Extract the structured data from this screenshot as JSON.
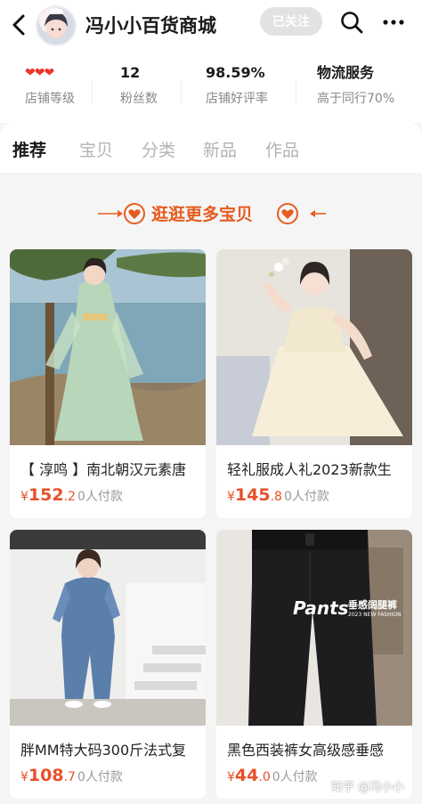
{
  "header": {
    "shop_name": "冯小小百货商城",
    "follow_label": "已关注"
  },
  "stats": [
    {
      "value": "❤❤❤",
      "label": "店铺等级"
    },
    {
      "value": "12",
      "label": "粉丝数"
    },
    {
      "value": "98.59%",
      "label": "店铺好评率"
    },
    {
      "value": "物流服务",
      "label": "高于同行70%"
    }
  ],
  "tabs": [
    {
      "label": "推荐",
      "active": true
    },
    {
      "label": "宝贝"
    },
    {
      "label": "分类"
    },
    {
      "label": "新品"
    },
    {
      "label": "作品"
    }
  ],
  "banner": {
    "text": "逛逛更多宝贝"
  },
  "products": [
    {
      "title": "【 淳鸣 】南北朝汉元素唐",
      "currency": "¥",
      "price_int": "152",
      "price_dec": ".2",
      "sold": "0人付款"
    },
    {
      "title": "轻礼服成人礼2023新款生",
      "currency": "¥",
      "price_int": "145",
      "price_dec": ".8",
      "sold": "0人付款"
    },
    {
      "title": "胖MM特大码300斤法式复",
      "currency": "¥",
      "price_int": "108",
      "price_dec": ".7",
      "sold": "0人付款"
    },
    {
      "title": "黑色西装裤女高级感垂感",
      "currency": "¥",
      "price_int": "44",
      "price_dec": ".0",
      "sold": "0人付款"
    }
  ],
  "product_overlay": {
    "brand": "Pants",
    "tagline": "垂感阔腿裤",
    "sub": "2023 NEW FASHION"
  },
  "watermark": "知乎 @冯小小",
  "colors": {
    "accent": "#e8502a",
    "heart": "#e8362d"
  }
}
